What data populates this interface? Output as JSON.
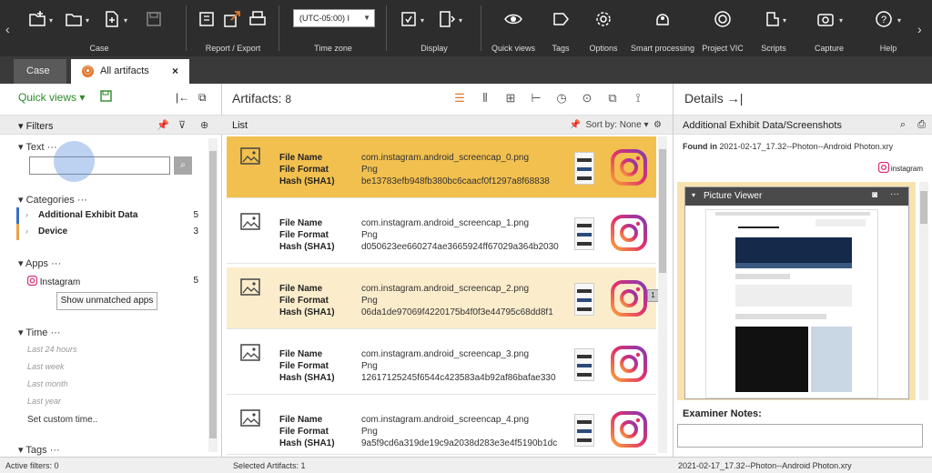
{
  "toolbar": {
    "groups": [
      {
        "id": "case",
        "label": "Case"
      },
      {
        "id": "report",
        "label": "Report / Export"
      },
      {
        "id": "timezone",
        "label": "Time zone",
        "value": "(UTC-05:00) I"
      },
      {
        "id": "display",
        "label": "Display"
      },
      {
        "id": "quickviews",
        "label": "Quick views"
      },
      {
        "id": "tags",
        "label": "Tags"
      },
      {
        "id": "options",
        "label": "Options"
      },
      {
        "id": "smart",
        "label": "Smart processing"
      },
      {
        "id": "vic",
        "label": "Project VIC"
      },
      {
        "id": "scripts",
        "label": "Scripts"
      },
      {
        "id": "capture",
        "label": "Capture"
      },
      {
        "id": "help",
        "label": "Help"
      }
    ]
  },
  "tabs": [
    {
      "label": "Case"
    },
    {
      "label": "All artifacts",
      "icon": "magnet-icon",
      "close": "×"
    }
  ],
  "left": {
    "quick_views": "Quick views",
    "filters_title": "Filters",
    "text_section": "Text",
    "categories_section": "Categories",
    "categories": [
      {
        "name": "Additional Exhibit Data",
        "count": "5",
        "color": "#3b6fc4"
      },
      {
        "name": "Device",
        "count": "3",
        "color": "#e8a34a"
      }
    ],
    "apps_section": "Apps",
    "apps": [
      {
        "name": "Instagram",
        "count": "5",
        "icon": "instagram-icon"
      }
    ],
    "show_unmatched": "Show unmatched apps",
    "time_section": "Time",
    "time_items": [
      "Last 24 hours",
      "Last week",
      "Last month",
      "Last year"
    ],
    "custom_time": "Set custom time..",
    "tags_section": "Tags"
  },
  "middle": {
    "title": "Artifacts:",
    "count": "8",
    "list_label": "List",
    "sort_label": "Sort by:",
    "sort_value": "None",
    "field_keys": [
      "File Name",
      "File Format",
      "Hash (SHA1)"
    ],
    "rows": [
      {
        "file_name": "com.instagram.android_screencap_0.png",
        "format": "Png",
        "hash": "be13783efb948fb380bc6caacf0f1297a8f68838",
        "state": "selected"
      },
      {
        "file_name": "com.instagram.android_screencap_1.png",
        "format": "Png",
        "hash": "d050623ee660274ae3665924ff67029a364b2030",
        "state": "normal"
      },
      {
        "file_name": "com.instagram.android_screencap_2.png",
        "format": "Png",
        "hash": "06da1de97069f4220175b4f0f3e44795c68dd8f1",
        "state": "hover",
        "badge": "1"
      },
      {
        "file_name": "com.instagram.android_screencap_3.png",
        "format": "Png",
        "hash": "12617125245f6544c423583a4b92af86bafae330",
        "state": "normal"
      },
      {
        "file_name": "com.instagram.android_screencap_4.png",
        "format": "Png",
        "hash": "9a5f9cd6a319de19c9a2038d283e3e4f5190b1dc",
        "state": "normal"
      }
    ]
  },
  "right": {
    "title": "Details",
    "section": "Additional Exhibit Data/Screenshots",
    "found_label": "Found in",
    "found_value": "2021-02-17_17.32--Photon--Android Photon.xry",
    "app_tag": "instagram",
    "picture_viewer": "Picture Viewer",
    "examiner_notes": "Examiner Notes:"
  },
  "status": {
    "active_filters": "Active filters: 0",
    "selected": "Selected Artifacts: 1",
    "source": "2021-02-17_17.32--Photon--Android Photon.xry"
  },
  "colors": {
    "toolbar_bg": "#2d2d2d",
    "accent_green": "#2b8a2b",
    "selected_row": "#f2c04f",
    "hover_row": "#fbedcc"
  }
}
